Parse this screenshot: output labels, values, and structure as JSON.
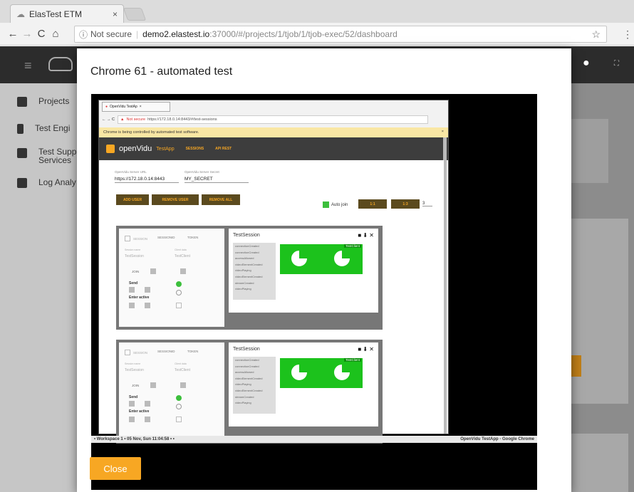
{
  "browser": {
    "tab_title": "ElasTest ETM",
    "tab_close": "×",
    "url_security": "Not secure",
    "url_host": "demo2.elastest.io",
    "url_path": ":37000/#/projects/1/tjob/1/tjob-exec/52/dashboard",
    "star": "☆",
    "menu": "⋮"
  },
  "app": {
    "sidebar": [
      {
        "label": "Projects"
      },
      {
        "label": "Test Engi"
      },
      {
        "label": "Test Supp\nServices"
      },
      {
        "label": "Log Analy"
      }
    ]
  },
  "modal": {
    "title": "Chrome 61 - automated test",
    "close_label": "Close"
  },
  "inner": {
    "tab_title": "OpenVidu TestAp",
    "tab_close": "×",
    "url_security": "Not secure",
    "url": "https://172.18.0.14:8443/#/test-sessions",
    "warning": "Chrome is being controlled by automated test software.",
    "warning_close": "×",
    "brand": "openVidu",
    "app_label": "TestApp",
    "nav": [
      "SESSIONS",
      "API REST"
    ],
    "server_url_label": "OpenVidu Server URL",
    "server_url": "https://172.18.0.14:8443",
    "server_secret_label": "OpenVidu Server Secret",
    "server_secret": "MY_SECRET",
    "buttons": [
      "ADD USER",
      "REMOVE USER",
      "REMOVE ALL"
    ],
    "autojoin_label": "Auto join",
    "ratio_buttons": [
      "1:1",
      "1:3"
    ],
    "count": "3",
    "panels": [
      {
        "session_title": "TestSession",
        "video_label": "TestClient",
        "events": [
          "connectionCreated",
          "connectionCreated",
          "accessAllowed",
          "videoElementCreated",
          "videoPlaying",
          "videoElementCreated",
          "streamCreated",
          "videoPlaying"
        ],
        "tab_labels": [
          "SESSION",
          "SESSIONID",
          "TOKEN"
        ],
        "session_name_label": "Session name",
        "session_name": "TestSession",
        "client_data_label": "Client data",
        "client_data": "TestClient",
        "join": "JOIN",
        "send": "Send",
        "enter_active": "Enter active"
      },
      {
        "session_title": "TestSession",
        "video_label": "TestClient",
        "events": [
          "connectionCreated",
          "connectionCreated",
          "accessAllowed",
          "videoElementCreated",
          "videoPlaying",
          "videoElementCreated",
          "streamCreated",
          "videoPlaying"
        ],
        "tab_labels": [
          "SESSION",
          "SESSIONID",
          "TOKEN"
        ],
        "session_name_label": "Session name",
        "session_name": "TestSession",
        "client_data_label": "Client data",
        "client_data": "TestClient",
        "join": "JOIN",
        "send": "Send",
        "enter_active": "Enter active"
      }
    ],
    "taskbar_left": "• Workspace 1 •  05 Nov, Sun 11:04:58  • •",
    "taskbar_right": "OpenVidu TestApp - Google Chrome"
  },
  "colors": {
    "accent": "#f7a723",
    "video": "#1cc21c",
    "appbar": "#2c2c2c"
  }
}
